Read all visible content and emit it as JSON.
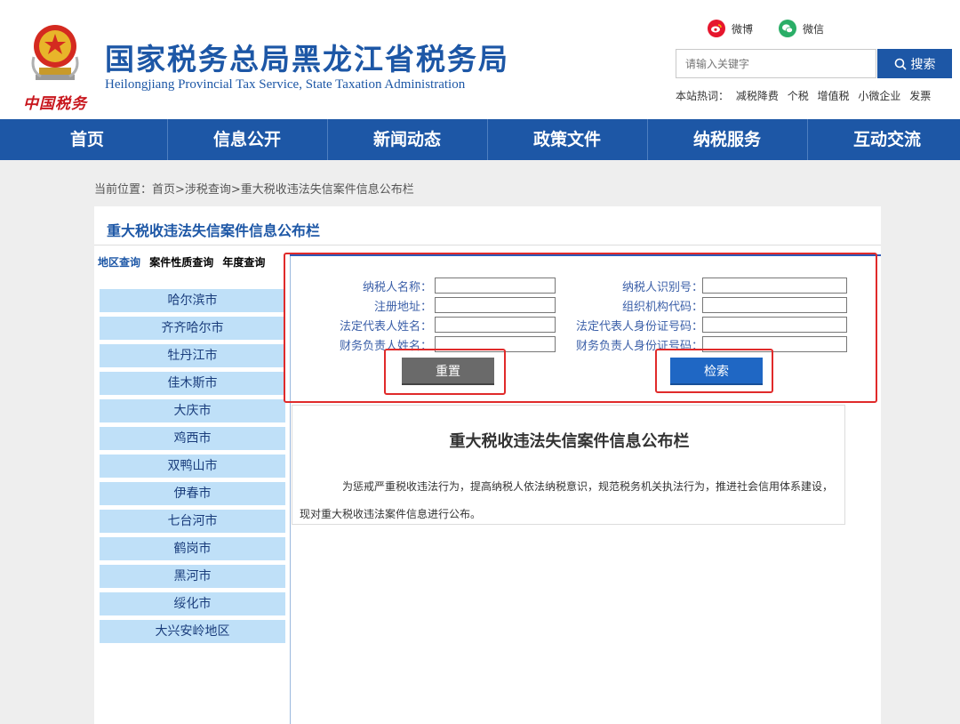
{
  "header": {
    "emblem_text": "中国税务",
    "title": "国家税务总局黑龙江省税务局",
    "subtitle": "Heilongjiang Provincial Tax Service, State Taxation Administration",
    "social": {
      "weibo_label": "微博",
      "wechat_label": "微信"
    },
    "search": {
      "placeholder": "请输入关键字",
      "button_label": "搜索"
    },
    "hot_words": {
      "label": "本站热词：",
      "items": [
        "减税降费",
        "个税",
        "增值税",
        "小微企业",
        "发票"
      ]
    }
  },
  "nav": {
    "items": [
      "首页",
      "信息公开",
      "新闻动态",
      "政策文件",
      "纳税服务",
      "互动交流"
    ]
  },
  "breadcrumb": "当前位置：首页>涉税查询>重大税收违法失信案件信息公布栏",
  "panel": {
    "title": "重大税收违法失信案件信息公布栏",
    "query_tabs": [
      "地区查询",
      "案件性质查询",
      "年度查询"
    ],
    "cities": [
      "哈尔滨市",
      "齐齐哈尔市",
      "牡丹江市",
      "佳木斯市",
      "大庆市",
      "鸡西市",
      "双鸭山市",
      "伊春市",
      "七台河市",
      "鹤岗市",
      "黑河市",
      "绥化市",
      "大兴安岭地区"
    ],
    "form": {
      "taxpayer_name": "纳税人名称：",
      "taxpayer_id": "纳税人识别号：",
      "reg_address": "注册地址：",
      "org_code": "组织机构代码：",
      "legal_rep_name": "法定代表人姓名：",
      "legal_rep_id": "法定代表人身份证号码：",
      "finance_name": "财务负责人姓名：",
      "finance_id": "财务负责人身份证号码：",
      "reset_label": "重置",
      "search_label": "检索"
    },
    "content": {
      "title": "重大税收违法失信案件信息公布栏",
      "text": "为惩戒严重税收违法行为，提高纳税人依法纳税意识，规范税务机关执法行为，推进社会信用体系建设，现对重大税收违法案件信息进行公布。"
    }
  },
  "colors": {
    "brand_blue": "#1d57a6",
    "highlight_red": "#e02a2a",
    "city_bg": "#bfe0f8"
  }
}
